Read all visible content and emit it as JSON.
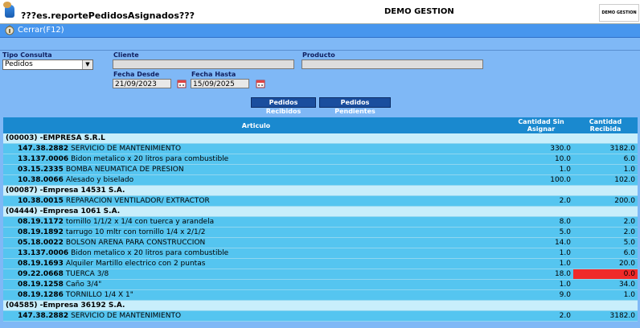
{
  "header": {
    "title": "???es.reportePedidosAsignados???",
    "system_name": "DEMO GESTION",
    "logo_text": "DEMO GESTION"
  },
  "toolbar": {
    "close_label": "Cerrar(F12)"
  },
  "filters": {
    "tipo_consulta_label": "Tipo Consulta",
    "tipo_consulta_value": "Pedidos",
    "cliente_label": "Cliente",
    "cliente_value": "",
    "producto_label": "Producto",
    "producto_value": "",
    "fecha_desde_label": "Fecha Desde",
    "fecha_desde_value": "21/09/2023",
    "fecha_hasta_label": "Fecha Hasta",
    "fecha_hasta_value": "15/09/2025"
  },
  "buttons": {
    "recibidos": "Pedidos Recibidos",
    "pendientes": "Pedidos Pendientes"
  },
  "table": {
    "headers": {
      "articulo": "Articulo",
      "sin_asignar": "Cantidad Sin Asignar",
      "recibida": "Cantidad Recibida"
    },
    "rows": [
      {
        "type": "group",
        "label": "(00003) -EMPRESA S.R.L"
      },
      {
        "type": "item",
        "code": "147.38.2882",
        "desc": "SERVICIO DE MANTENIMIENTO",
        "sin_asignar": "330.0",
        "recibida": "3182.0"
      },
      {
        "type": "item",
        "code": "13.137.0006",
        "desc": "Bidon metalico x 20 litros para combustible",
        "sin_asignar": "10.0",
        "recibida": "6.0"
      },
      {
        "type": "item",
        "code": "03.15.2335",
        "desc": "BOMBA NEUMATICA DE PRESION",
        "sin_asignar": "1.0",
        "recibida": "1.0"
      },
      {
        "type": "item",
        "code": "10.38.0066",
        "desc": "Alesado y biselado",
        "sin_asignar": "100.0",
        "recibida": "102.0"
      },
      {
        "type": "group",
        "label": "(00087) -Empresa 14531 S.A."
      },
      {
        "type": "item",
        "code": "10.38.0015",
        "desc": "REPARACION VENTILADOR/ EXTRACTOR",
        "sin_asignar": "2.0",
        "recibida": "200.0"
      },
      {
        "type": "group",
        "label": "(04444) -Empresa 1061 S.A."
      },
      {
        "type": "item",
        "code": "08.19.1172",
        "desc": "tornillo 1/1/2 x 1/4 con tuerca y arandela",
        "sin_asignar": "8.0",
        "recibida": "2.0"
      },
      {
        "type": "item",
        "code": "08.19.1892",
        "desc": "tarrugo 10 mltr con tornillo 1/4 x 2/1/2",
        "sin_asignar": "5.0",
        "recibida": "2.0"
      },
      {
        "type": "item",
        "code": "05.18.0022",
        "desc": "BOLSON ARENA PARA CONSTRUCCION",
        "sin_asignar": "14.0",
        "recibida": "5.0"
      },
      {
        "type": "item",
        "code": "13.137.0006",
        "desc": "Bidon metalico x 20 litros para combustible",
        "sin_asignar": "1.0",
        "recibida": "6.0"
      },
      {
        "type": "item",
        "code": "08.19.1693",
        "desc": "Alquiler Martillo electrico con 2 puntas",
        "sin_asignar": "1.0",
        "recibida": "20.0"
      },
      {
        "type": "item",
        "code": "09.22.0668",
        "desc": "TUERCA 3/8",
        "sin_asignar": "18.0",
        "recibida": "0.0",
        "alert": true
      },
      {
        "type": "item",
        "code": "08.19.1258",
        "desc": "Caño 3/4\"",
        "sin_asignar": "1.0",
        "recibida": "34.0"
      },
      {
        "type": "item",
        "code": "08.19.1286",
        "desc": "TORNILLO 1/4 X 1\"",
        "sin_asignar": "9.0",
        "recibida": "1.0"
      },
      {
        "type": "group",
        "label": "(04585) -Empresa 36192 S.A."
      },
      {
        "type": "item",
        "code": "147.38.2882",
        "desc": "SERVICIO DE MANTENIMIENTO",
        "sin_asignar": "2.0",
        "recibida": "3182.0"
      }
    ]
  },
  "colors": {
    "background": "#7fb8f6",
    "header_row": "#1a89cf",
    "group_row": "#c8eefb",
    "item_row": "#55c5f0",
    "alert": "#f02a2a"
  }
}
